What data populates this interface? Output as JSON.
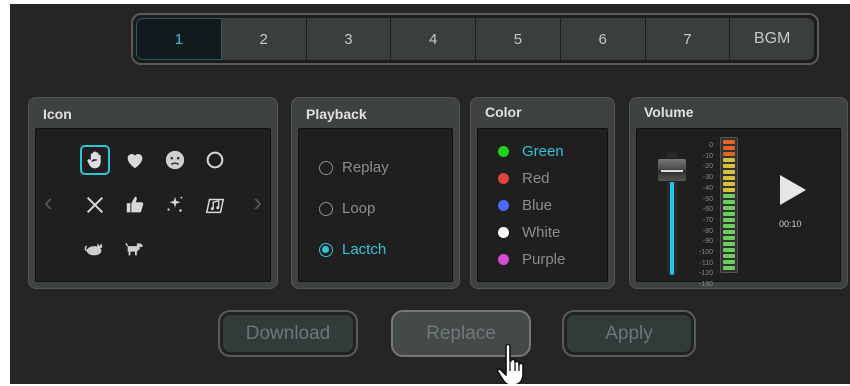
{
  "tabs": [
    "1",
    "2",
    "3",
    "4",
    "5",
    "6",
    "7",
    "BGM"
  ],
  "active_tab": "1",
  "icon_panel": {
    "title": "Icon",
    "icons": [
      "hand-icon",
      "heart-icon",
      "sad-face-icon",
      "circle-icon",
      "x-icon",
      "thumbs-up-icon",
      "sparkle-icon",
      "music-note-icon",
      "cat-icon",
      "dog-icon"
    ],
    "selected_icon": "hand-icon",
    "nav_prev": "‹",
    "nav_next": "›"
  },
  "playback_panel": {
    "title": "Playback",
    "options": [
      "Replay",
      "Loop",
      "Lactch"
    ],
    "selected": "Lactch"
  },
  "color_panel": {
    "title": "Color",
    "options": [
      {
        "label": "Green",
        "color": "#1fd11f"
      },
      {
        "label": "Red",
        "color": "#e0443d"
      },
      {
        "label": "Blue",
        "color": "#4b6bff"
      },
      {
        "label": "White",
        "color": "#ffffff"
      },
      {
        "label": "Purple",
        "color": "#d64ed8"
      }
    ],
    "selected": "Green"
  },
  "volume_panel": {
    "title": "Volume",
    "db_labels": [
      "0",
      "-10",
      "-20",
      "-30",
      "-40",
      "-50",
      "-60",
      "-70",
      "-80",
      "-90",
      "-100",
      "-110",
      "-120",
      "-130"
    ],
    "level_fraction": 0.85,
    "time": "00:10"
  },
  "buttons": {
    "download": "Download",
    "replace": "Replace",
    "apply": "Apply"
  },
  "colors": {
    "accent": "#2fc4d8",
    "background": "#252525",
    "panel": "#3f4242"
  }
}
